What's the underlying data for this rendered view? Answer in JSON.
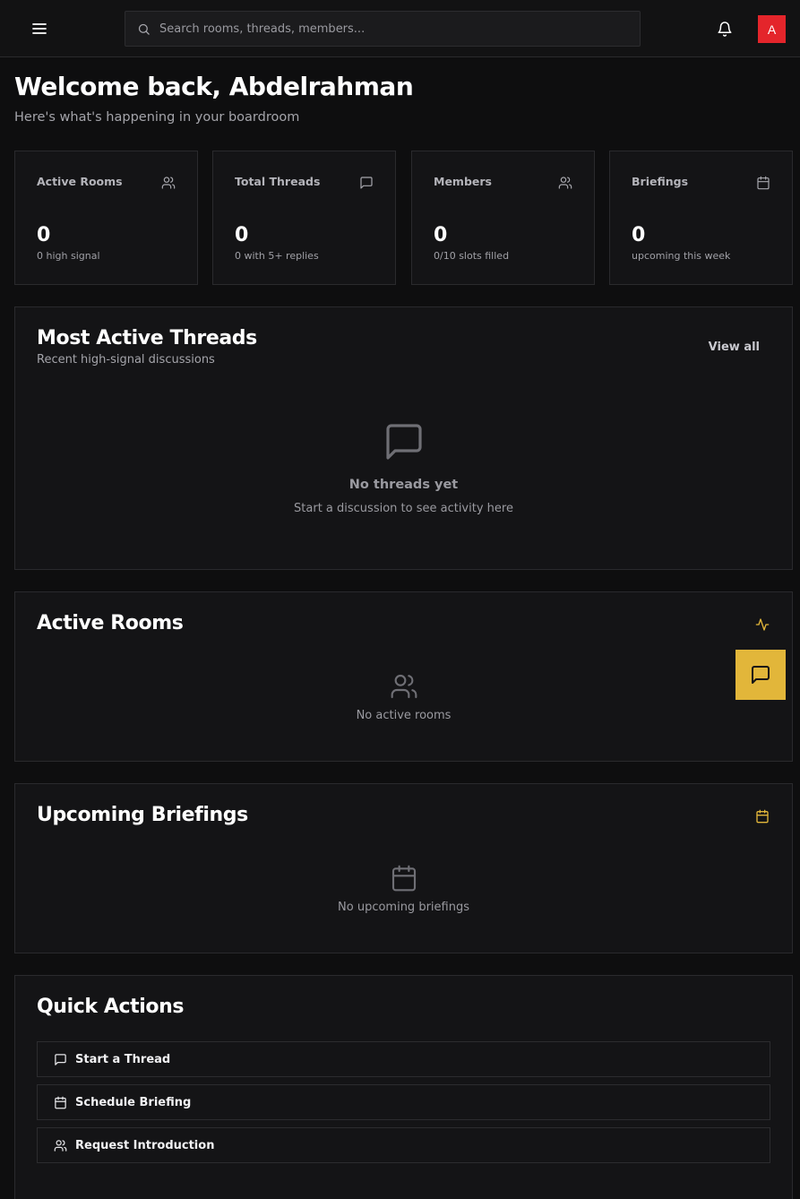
{
  "topbar": {
    "search_placeholder": "Search rooms, threads, members...",
    "avatar_initial": "A"
  },
  "welcome": {
    "title": "Welcome back, Abdelrahman",
    "subtitle": "Here's what's happening in your boardroom"
  },
  "stats": [
    {
      "label": "Active Rooms",
      "value": "0",
      "sub": "0 high signal",
      "icon": "users-icon"
    },
    {
      "label": "Total Threads",
      "value": "0",
      "sub": "0 with 5+ replies",
      "icon": "message-square-icon"
    },
    {
      "label": "Members",
      "value": "0",
      "sub": "0/10 slots filled",
      "icon": "users-icon"
    },
    {
      "label": "Briefings",
      "value": "0",
      "sub": "upcoming this week",
      "icon": "calendar-icon"
    }
  ],
  "threads": {
    "title": "Most Active Threads",
    "subtitle": "Recent high-signal discussions",
    "view_all": "View all",
    "empty_title": "No threads yet",
    "empty_sub": "Start a discussion to see activity here"
  },
  "rooms": {
    "title": "Active Rooms",
    "empty": "No active rooms"
  },
  "briefings": {
    "title": "Upcoming Briefings",
    "empty": "No upcoming briefings"
  },
  "quick_actions": {
    "title": "Quick Actions",
    "items": [
      {
        "label": "Start a Thread",
        "icon": "message-square-icon"
      },
      {
        "label": "Schedule Briefing",
        "icon": "calendar-icon"
      },
      {
        "label": "Request Introduction",
        "icon": "users-icon"
      }
    ]
  },
  "colors": {
    "accent": "#e2b63a",
    "avatar": "#e4252b",
    "background": "#0e0e0f",
    "card": "#141416"
  }
}
